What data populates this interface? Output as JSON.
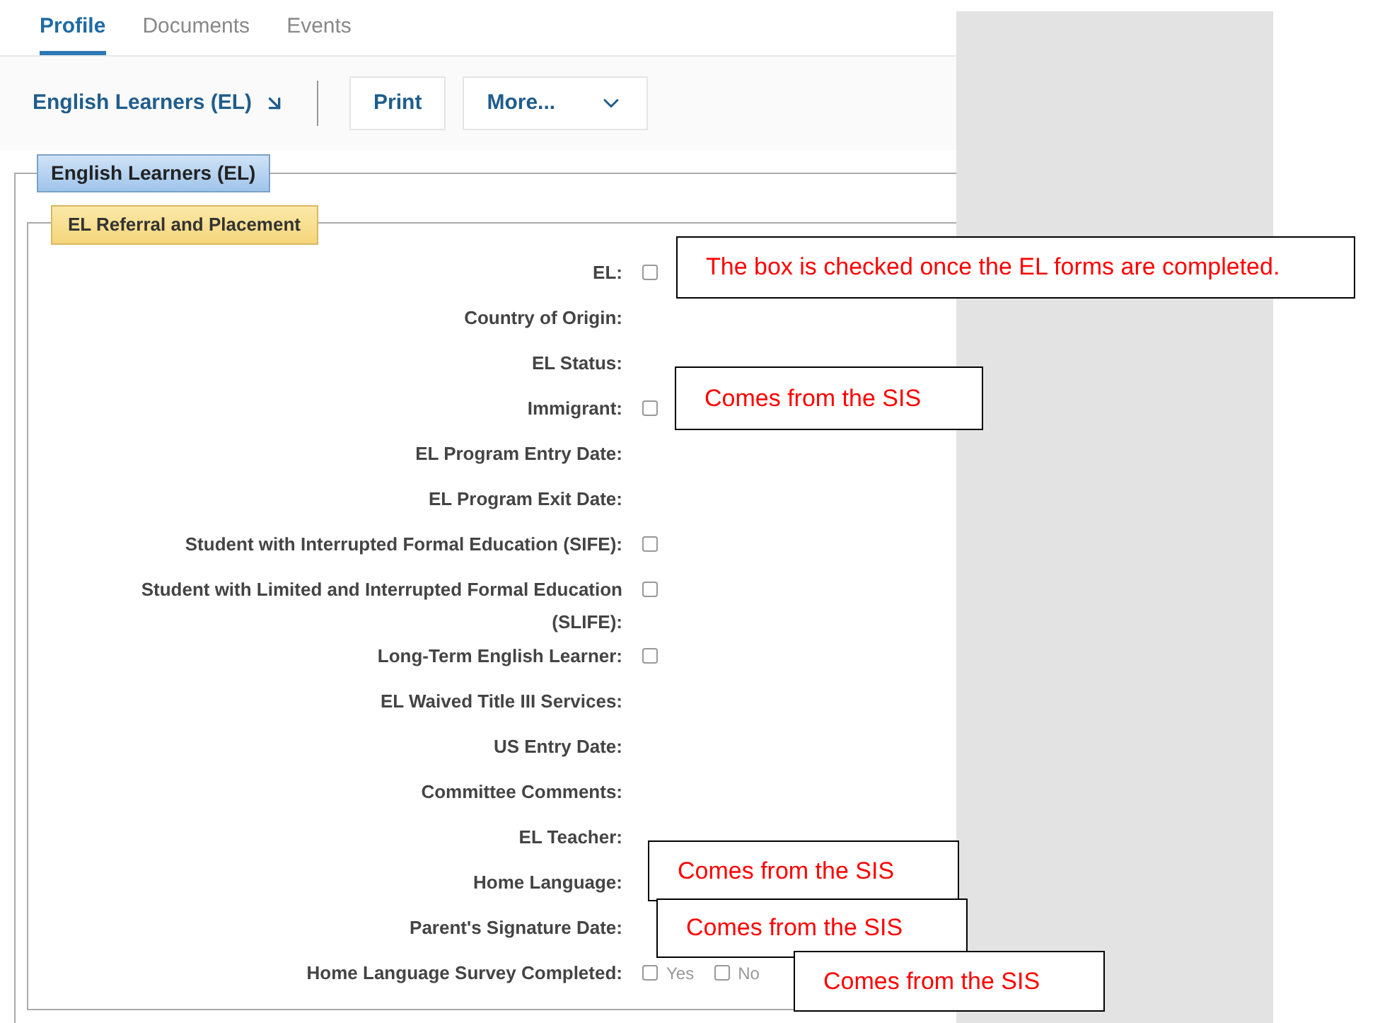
{
  "tabs": [
    {
      "label": "Profile",
      "selected": true
    },
    {
      "label": "Documents",
      "selected": false
    },
    {
      "label": "Events",
      "selected": false
    }
  ],
  "toolbar": {
    "title_link": "English Learners (EL)",
    "buttons": [
      {
        "label": "Print",
        "kind": "plain"
      },
      {
        "label": "More...",
        "kind": "menu"
      }
    ]
  },
  "section": {
    "title": "English Learners (EL)",
    "group": {
      "title": "EL Referral and Placement",
      "fields": [
        {
          "kind": "checkbox",
          "label": "EL:",
          "checked": false
        },
        {
          "kind": "text",
          "label": "Country of Origin:"
        },
        {
          "kind": "text",
          "label": "EL Status:"
        },
        {
          "kind": "checkbox",
          "label": "Immigrant:",
          "checked": false
        },
        {
          "kind": "text",
          "label": "EL Program Entry Date:"
        },
        {
          "kind": "text",
          "label": "EL Program Exit Date:"
        },
        {
          "kind": "checkbox",
          "label": "Student with Interrupted Formal Education (SIFE):",
          "checked": false
        },
        {
          "kind": "checkbox",
          "label": "Student with Limited and Interrupted Formal Education (SLIFE):",
          "checked": false
        },
        {
          "kind": "checkbox",
          "label": "Long-Term English Learner:",
          "checked": false
        },
        {
          "kind": "text",
          "label": "EL Waived Title III Services:"
        },
        {
          "kind": "text",
          "label": "US Entry Date:"
        },
        {
          "kind": "text",
          "label": "Committee Comments:"
        },
        {
          "kind": "text",
          "label": "EL Teacher:"
        },
        {
          "kind": "text",
          "label": "Home Language:"
        },
        {
          "kind": "text",
          "label": "Parent's Signature Date:"
        },
        {
          "kind": "options",
          "label": "Home Language Survey Completed:",
          "options": [
            {
              "label": "Yes",
              "checked": false
            },
            {
              "label": "No",
              "checked": false
            }
          ]
        }
      ]
    }
  },
  "annotations": [
    {
      "text": "The box is checked once the EL forms are completed."
    },
    {
      "text": "Comes from the SIS"
    },
    {
      "text": "Comes from the SIS"
    },
    {
      "text": "Comes from the SIS"
    },
    {
      "text": "Comes from the SIS"
    }
  ]
}
